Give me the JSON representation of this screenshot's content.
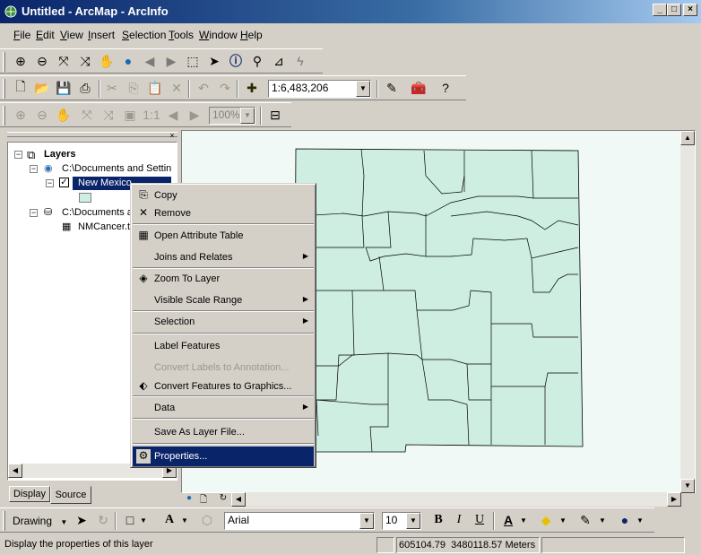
{
  "window": {
    "title": "Untitled - ArcMap - ArcInfo",
    "buttons": [
      "_",
      "□",
      "×"
    ]
  },
  "menubar": {
    "items": [
      {
        "key": "F",
        "rest": "ile"
      },
      {
        "key": "E",
        "rest": "dit"
      },
      {
        "key": "V",
        "rest": "iew"
      },
      {
        "key": "I",
        "rest": "nsert"
      },
      {
        "key": "S",
        "rest": "election"
      },
      {
        "key": "T",
        "rest": "ools"
      },
      {
        "key": "W",
        "rest": "indow"
      },
      {
        "key": "H",
        "rest": "elp"
      }
    ]
  },
  "standard_toolbar": {
    "scale_value": "1:6,483,206"
  },
  "layout_toolbar": {
    "zoom_value": "100%"
  },
  "toc": {
    "root_label": "Layers",
    "items": [
      {
        "label": "C:\\Documents and Settin"
      },
      {
        "label": "New Mexico"
      },
      {
        "label": "C:\\Documents a"
      },
      {
        "label": "NMCancer.t"
      }
    ],
    "tabs": [
      "Display",
      "Source"
    ],
    "active_tab": "Source"
  },
  "map": {
    "fill_color": "#cdeee0",
    "stroke_color": "#000000",
    "background": "#f0f9f6"
  },
  "context_menu": {
    "items": [
      {
        "label": "Copy",
        "icon": "copy-icon",
        "submenu": false,
        "disabled": false
      },
      {
        "label": "Remove",
        "icon": "remove-icon",
        "submenu": false,
        "disabled": false
      },
      {
        "label": "Open Attribute Table",
        "icon": "table-icon",
        "submenu": false,
        "disabled": false
      },
      {
        "label": "Joins and Relates",
        "icon": "",
        "submenu": true,
        "disabled": false
      },
      {
        "label": "Zoom To Layer",
        "icon": "zoom-layer-icon",
        "submenu": false,
        "disabled": false
      },
      {
        "label": "Visible Scale Range",
        "icon": "",
        "submenu": true,
        "disabled": false
      },
      {
        "label": "Selection",
        "icon": "",
        "submenu": true,
        "disabled": false
      },
      {
        "label": "Label Features",
        "icon": "",
        "submenu": false,
        "disabled": false
      },
      {
        "label": "Convert Labels to Annotation...",
        "icon": "",
        "submenu": false,
        "disabled": true
      },
      {
        "label": "Convert Features to Graphics...",
        "icon": "convert-graphics-icon",
        "submenu": false,
        "disabled": false
      },
      {
        "label": "Data",
        "icon": "",
        "submenu": true,
        "disabled": false
      },
      {
        "label": "Save As Layer File...",
        "icon": "",
        "submenu": false,
        "disabled": false
      },
      {
        "label": "Properties...",
        "icon": "properties-icon",
        "submenu": false,
        "disabled": false,
        "selected": true
      }
    ]
  },
  "drawing_toolbar": {
    "drawing_label": "Drawing",
    "font_name": "Arial",
    "font_size": "10",
    "bold": "B",
    "italic": "I",
    "underline": "U"
  },
  "status": {
    "message": "Display the properties of this layer",
    "coordinates": "605104.79  3480118.57 Meters"
  }
}
